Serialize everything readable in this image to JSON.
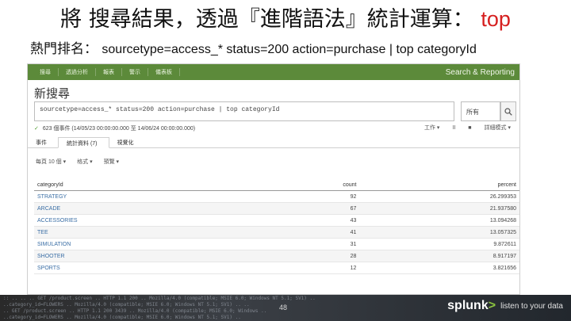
{
  "slide": {
    "title_main": "將 搜尋結果，透過『進階語法』統計運算：",
    "title_accent": "top",
    "subtitle_label": "熱門排名：",
    "subtitle_command": "sourcetype=access_* status=200 action=purchase | top categoryId",
    "page_number": "48"
  },
  "app": {
    "nav_items": [
      "搜尋",
      "透過分析",
      "報表",
      "警示",
      "儀表板"
    ],
    "app_name": "Search & Reporting",
    "search_heading": "新搜尋",
    "search_query": "sourcetype=access_* status=200 action=purchase | top categoryId",
    "time_picker": "所有",
    "status": "623 個事件 (14/05/23 00:00:00.000 至 14/06/24 00:00:00.000)",
    "job_controls": [
      "工作 ▾",
      "II",
      "■",
      "詳細模式 ▾"
    ],
    "tabs": [
      "事件",
      "統計資料 (7)",
      "視覺化"
    ],
    "format_options": [
      "每頁 10 個 ▾",
      "格式 ▾",
      "預覽 ▾"
    ]
  },
  "table": {
    "columns": [
      "categoryId",
      "count",
      "percent"
    ],
    "rows": [
      [
        "STRATEGY",
        "92",
        "26.299353"
      ],
      [
        "ARCADE",
        "67",
        "21.937580"
      ],
      [
        "ACCESSORIES",
        "43",
        "13.094268"
      ],
      [
        "TEE",
        "41",
        "13.057325"
      ],
      [
        "SIMULATION",
        "31",
        "9.872611"
      ],
      [
        "SHOOTER",
        "28",
        "8.917197"
      ],
      [
        "SPORTS",
        "12",
        "3.821656"
      ]
    ]
  },
  "brand": {
    "logo_text": "splunk",
    "logo_mark": ">",
    "tagline": "listen to your data"
  },
  "colors": {
    "app_bar": "#5c8a3a",
    "title_accent": "#d62020",
    "logo_mark": "#8dc63f"
  }
}
